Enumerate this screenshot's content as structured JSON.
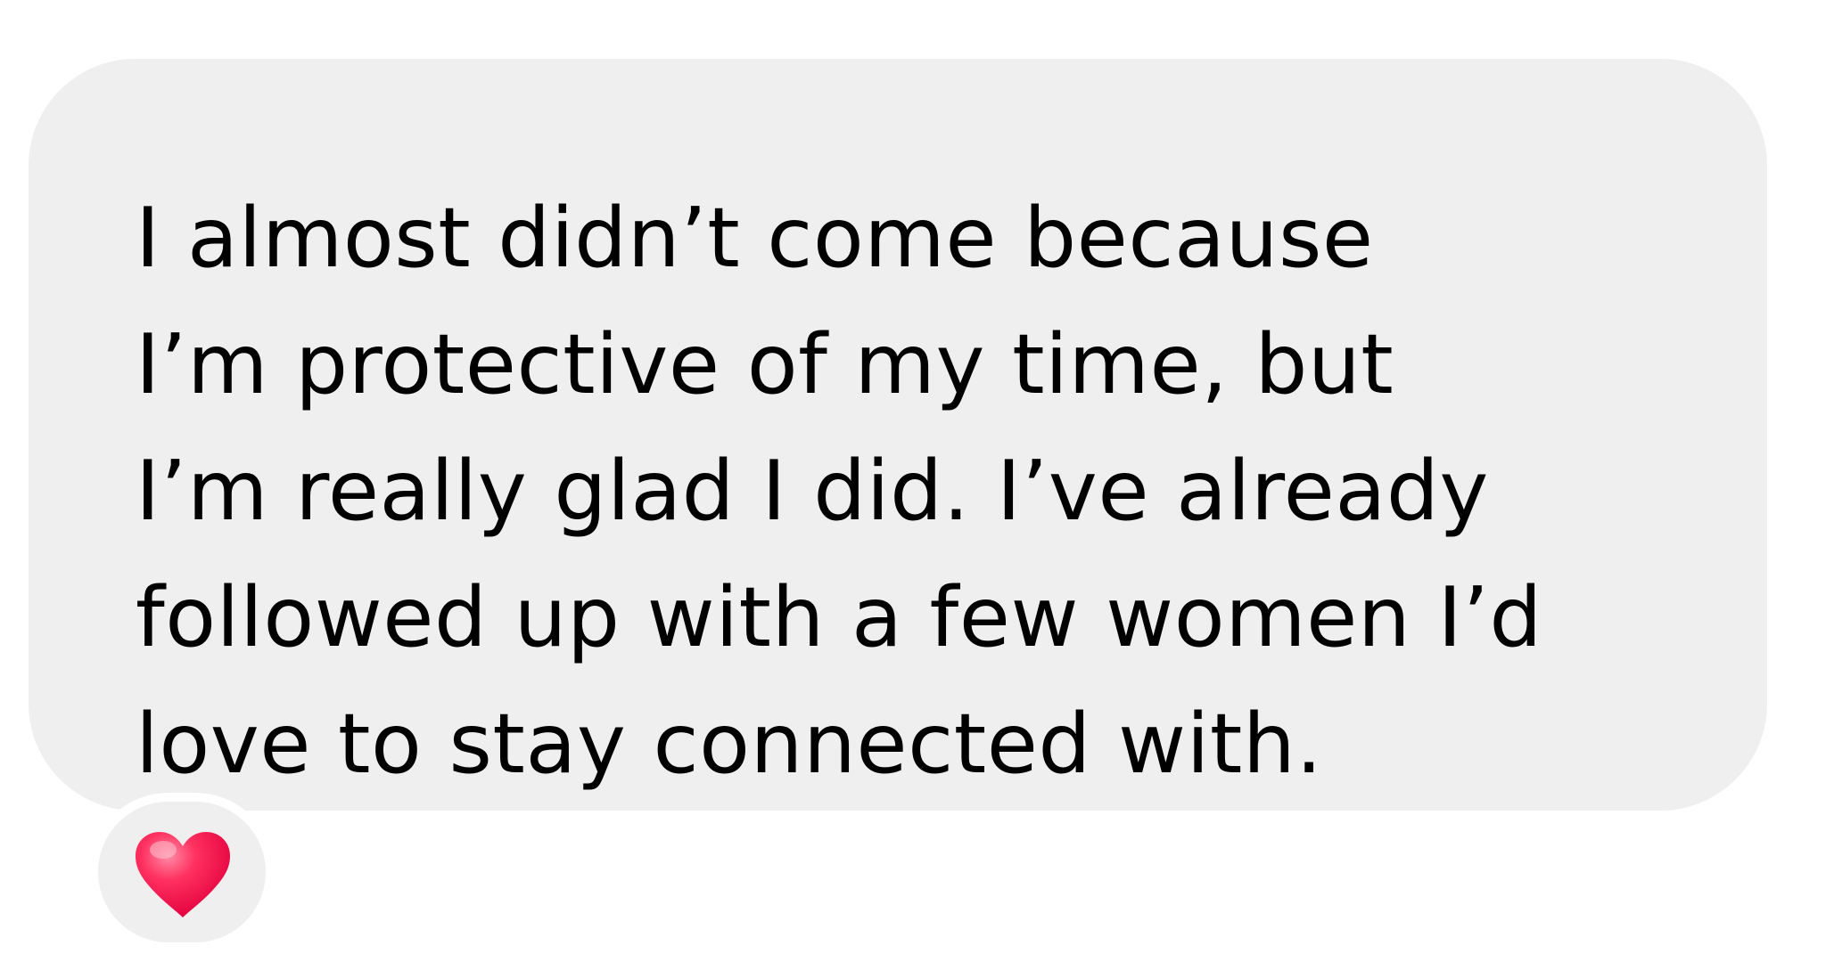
{
  "message": {
    "lines": [
      "I almost didn’t come because",
      "I’m protective of my time, but",
      "I’m really glad I did. I’ve already",
      "followed up with a few women I’d",
      "love to stay connected with."
    ]
  },
  "reaction": {
    "icon": "heart-icon",
    "color": "#ff1f5a"
  },
  "colors": {
    "bubble_background": "#efefef",
    "text": "#000000",
    "page_background": "#ffffff"
  }
}
